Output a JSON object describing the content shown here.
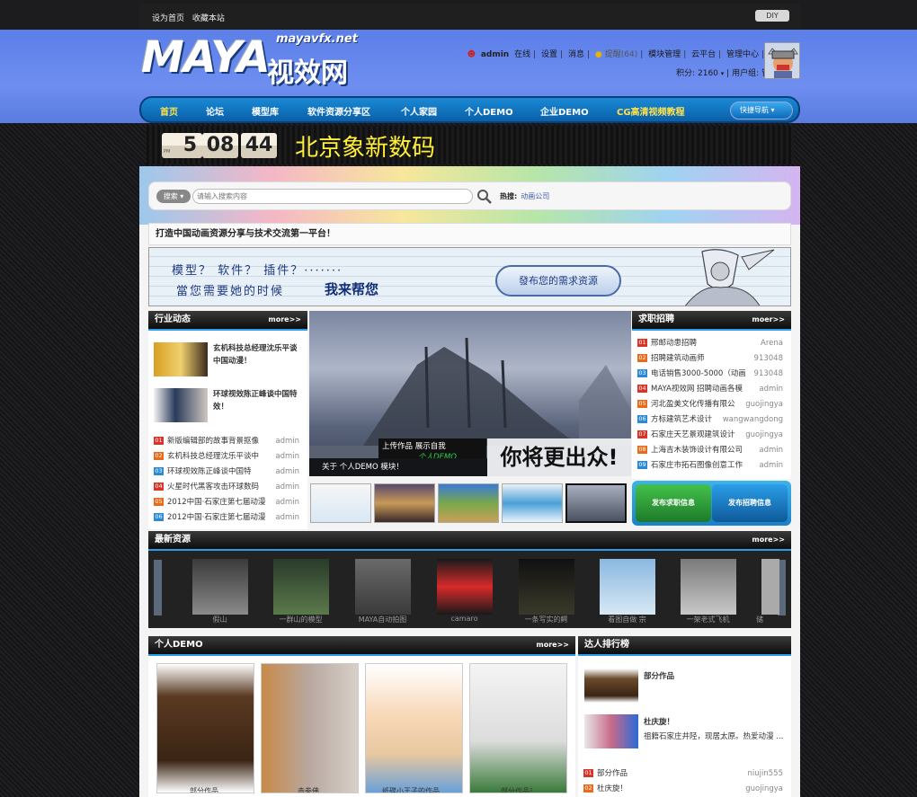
{
  "topbar": {
    "set_home": "设为首页",
    "bookmark": "收藏本站",
    "diy": "DIY"
  },
  "logo": {
    "maya": "MAYA",
    "cn": "视效网",
    "url": "mayavfx.net"
  },
  "user": {
    "name": "admin",
    "status": "在线",
    "links": [
      "设置",
      "消息",
      "提醒(64)",
      "模块管理",
      "云平台",
      "管理中心",
      "退出"
    ],
    "points": "积分: 2160",
    "group": "用户组: 管理员"
  },
  "nav": {
    "items": [
      "首页",
      "论坛",
      "模型库",
      "软件资源分享区",
      "个人家园",
      "个人DEMO",
      "企业DEMO",
      "CG高清视频教程"
    ],
    "quick": "快捷导航"
  },
  "ad": {
    "clock": [
      "5",
      "08",
      "44"
    ],
    "clock_ampm": "PM",
    "text": "北京象新数码"
  },
  "search": {
    "scope": "搜索",
    "placeholder": "请输入搜索内容",
    "hot_label": "热搜:",
    "hot_item": "动画公司"
  },
  "slogan": "打造中国动画资源分享与技术交流第一平台！",
  "banner": {
    "line1": "模型？ 软件？ 插件？·······",
    "line2": "當您需要她的时候",
    "line3": "我来帮您",
    "button": "發布您的需求资源"
  },
  "industry": {
    "title": "行业动态",
    "more": "more>>",
    "features": [
      {
        "text": "玄机科技总经理沈乐平谈中国动漫！"
      },
      {
        "text": "环球视效陈正峰谈中国特效！"
      }
    ],
    "items": [
      {
        "num": "01",
        "title": "新版编辑部的故事背景抠像",
        "author": "admin"
      },
      {
        "num": "02",
        "title": "玄机科技总经理沈乐平谈中",
        "author": "admin"
      },
      {
        "num": "03",
        "title": "环球视效陈正峰谈中国特",
        "author": "admin"
      },
      {
        "num": "04",
        "title": "火星时代黑客攻击环球数码",
        "author": "admin"
      },
      {
        "num": "05",
        "title": "2012中国·石家庄第七届动漫",
        "author": "admin"
      },
      {
        "num": "06",
        "title": "2012中国·石家庄第七届动漫",
        "author": "admin"
      }
    ]
  },
  "slideshow": {
    "caption": "关于 个人DEMO 模块！",
    "upload": "上传作品  展示自我",
    "demo": "个人DEMO",
    "slogan": "你将更出众!"
  },
  "jobs": {
    "title": "求职招聘",
    "more": "moer>>",
    "items": [
      {
        "num": "01",
        "title": "邢邮动患招聘",
        "author": "Arena"
      },
      {
        "num": "02",
        "title": "招聘建筑动画师",
        "author": "913048"
      },
      {
        "num": "03",
        "title": "电话销售3000-5000（动画",
        "author": "913048"
      },
      {
        "num": "04",
        "title": "MAYA视效网 招聘动画各模",
        "author": "admin"
      },
      {
        "num": "05",
        "title": "河北盈美文化传播有限公",
        "author": "guojingya"
      },
      {
        "num": "06",
        "title": "方标建筑艺术设计",
        "author": "wangwangdong"
      },
      {
        "num": "07",
        "title": "石家庄天艺景观建筑设计",
        "author": "guojingya"
      },
      {
        "num": "08",
        "title": "上海吉木装饰设计有限公司",
        "author": "admin"
      },
      {
        "num": "09",
        "title": "石家庄市拓石图像创意工作",
        "author": "admin"
      }
    ],
    "btn_seek": "发布求职信息",
    "btn_hire": "发布招聘信息"
  },
  "latest": {
    "title": "最新资源",
    "more": "more>>",
    "items": [
      "假山",
      "一群山的模型",
      "MAYA自动拍图",
      "camaro",
      "一条写实的鳄",
      "看图自做 宗",
      "一架老式飞机",
      "储"
    ]
  },
  "demo": {
    "title": "个人DEMO",
    "more": "more>>",
    "items": [
      "部分作品",
      "赤拳佛",
      "纸碟小王子的作品",
      "部分作品！"
    ]
  },
  "rank": {
    "title": "达人排行榜",
    "features": [
      {
        "title": "部分作品",
        "desc": ""
      },
      {
        "title": "杜庆旋！",
        "desc": "祖籍石家庄井陉，现居太原。热爱动漫 ..."
      }
    ],
    "items": [
      {
        "num": "01",
        "title": "部分作品",
        "author": "niujin555"
      },
      {
        "num": "02",
        "title": "杜庆旋！",
        "author": "guojingya"
      }
    ]
  }
}
